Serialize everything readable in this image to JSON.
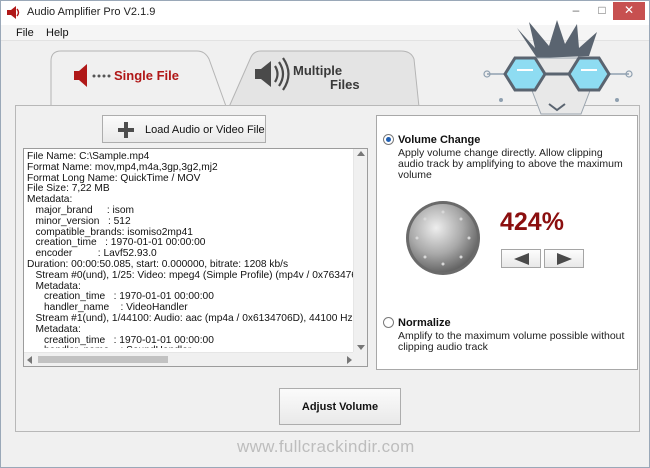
{
  "window": {
    "title": "Audio Amplifier Pro V2.1.9",
    "controls": {
      "minimize": "–",
      "maximize": "□",
      "close": "✕"
    }
  },
  "menu": {
    "file": "File",
    "help": "Help"
  },
  "tabs": {
    "single": {
      "label": "Single File",
      "icon": "speaker-dots-icon",
      "active": true
    },
    "multiple": {
      "label_line1": "Multiple",
      "label_line2": "Files",
      "icon": "speaker-waves-icon",
      "active": false
    }
  },
  "load_button": {
    "label": "Load Audio or Video File",
    "icon": "plus-icon"
  },
  "file_info": [
    "File Name: C:\\Sample.mp4",
    "Format Name: mov,mp4,m4a,3gp,3g2,mj2",
    "Format Long Name: QuickTime / MOV",
    "File Size: 7,22 MB",
    "Metadata:",
    "   major_brand     : isom",
    "   minor_version   : 512",
    "   compatible_brands: isomiso2mp41",
    "   creation_time   : 1970-01-01 00:00:00",
    "   encoder         : Lavf52.93.0",
    "Duration: 00:00:50.085, start: 0.000000, bitrate: 1208 kb/s",
    "   Stream #0(und), 1/25: Video: mpeg4 (Simple Profile) (mp4v / 0x763476",
    "   Metadata:",
    "      creation_time   : 1970-01-01 00:00:00",
    "      handler_name    : VideoHandler",
    "   Stream #1(und), 1/44100: Audio: aac (mp4a / 0x6134706D), 44100 Hz,",
    "   Metadata:",
    "      creation_time   : 1970-01-01 00:00:00",
    "      handler_name    : SoundHandler"
  ],
  "volume_change": {
    "title": "Volume Change",
    "description": "Apply volume change directly. Allow clipping audio track by amplifying to above the maximum volume",
    "selected": true,
    "percent_text": "424%",
    "percent_value": 424
  },
  "normalize": {
    "title": "Normalize",
    "description": "Amplify to the maximum volume possible without clipping audio track",
    "selected": false
  },
  "adjust_button": {
    "label": "Adjust Volume"
  },
  "watermark": "www.fullcrackindir.com",
  "colors": {
    "accent_red": "#b01818",
    "percent_red": "#8b0f0f",
    "radio_blue": "#1f5fb3",
    "mascot_cyan": "#5ec8e8"
  }
}
